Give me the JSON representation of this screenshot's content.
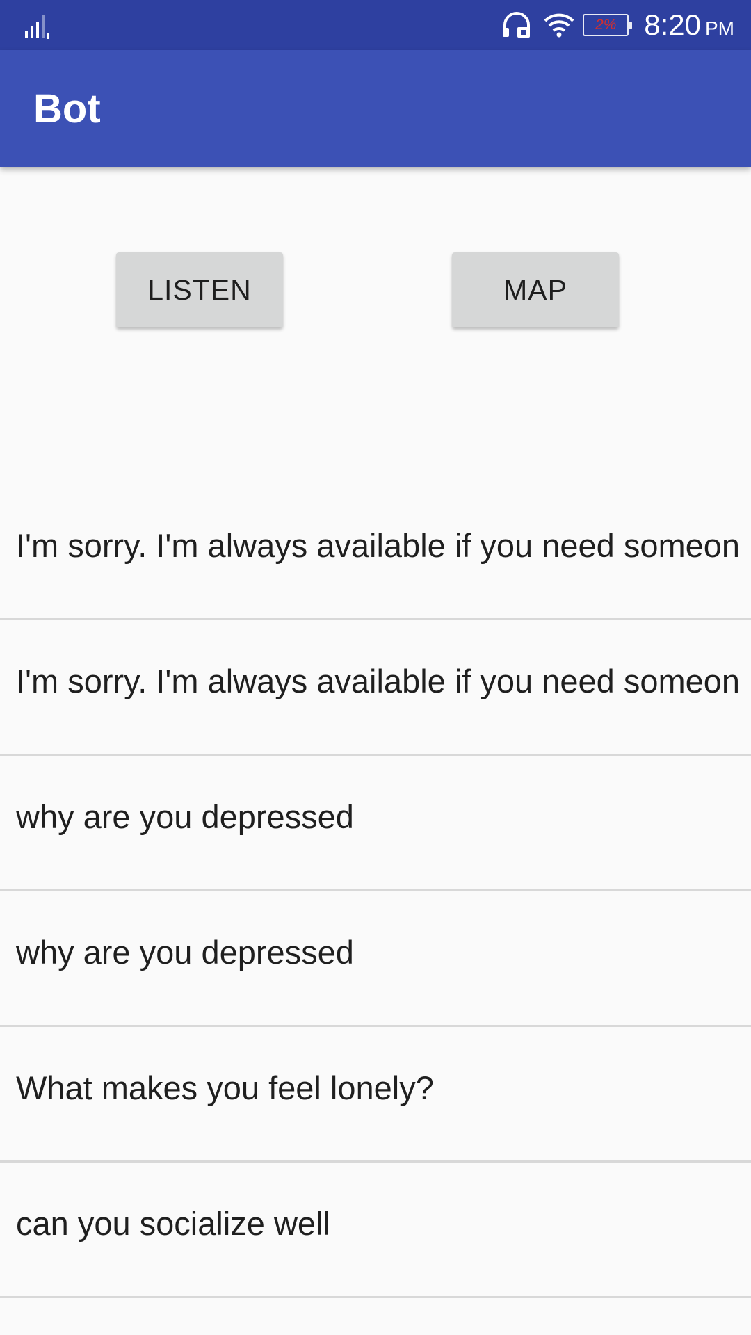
{
  "status_bar": {
    "icons": [
      "signal-icon",
      "headset-icon",
      "wifi-icon",
      "battery-icon"
    ],
    "battery_text": "2%",
    "battery_level": 0.02,
    "time": "8:20",
    "ampm": "PM"
  },
  "app_bar": {
    "title": "Bot"
  },
  "buttons": {
    "listen_label": "LISTEN",
    "map_label": "MAP"
  },
  "messages": [
    {
      "text": "I'm sorry. I'm always available if you need someon"
    },
    {
      "text": "I'm sorry. I'm always available if you need someon"
    },
    {
      "text": "why are you depressed"
    },
    {
      "text": "why are you depressed"
    },
    {
      "text": "What makes you feel lonely?"
    },
    {
      "text": "can you socialize well"
    }
  ],
  "colors": {
    "status_bar": "#2e40a0",
    "app_bar": "#3c51b5",
    "background": "#fafafa",
    "button": "#d6d7d7",
    "battery_low": "#d32f2f"
  }
}
